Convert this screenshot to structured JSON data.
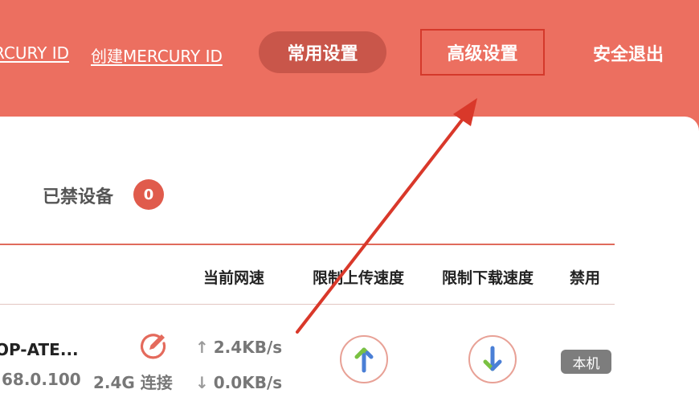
{
  "header": {
    "login_link": "RCURY ID",
    "create_link": "创建MERCURY ID",
    "nav_common": "常用设置",
    "nav_advanced": "高级设置",
    "nav_logout": "安全退出"
  },
  "blocked": {
    "label": "已禁设备",
    "count": "0"
  },
  "table": {
    "headers": {
      "speed": "当前网速",
      "limit_up": "限制上传速度",
      "limit_down": "限制下载速度",
      "ban": "禁用"
    },
    "rows": [
      {
        "name": "OP-ATE...",
        "ip": "68.0.100",
        "connection": "2.4G 连接",
        "up_arrow": "↑",
        "up_speed": "2.4KB/s",
        "down_arrow": "↓",
        "down_speed": "0.0KB/s",
        "tag": "本机"
      }
    ]
  },
  "colors": {
    "header_bg": "#ec6f60",
    "pill_bg": "#c9564a",
    "highlight_border": "#d4392b",
    "badge_bg": "#e05b4c",
    "arrow_blue": "#4a7fd6",
    "arrow_green": "#7ac142"
  },
  "icons": {
    "edit": "edit-icon",
    "upload": "upload-arrow-icon",
    "download": "download-arrow-icon"
  }
}
